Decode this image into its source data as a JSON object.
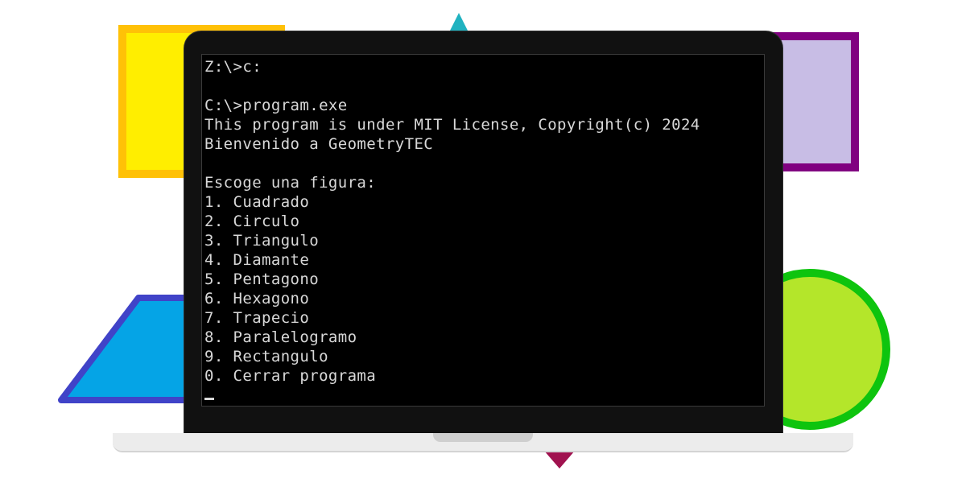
{
  "terminal": {
    "lines": [
      "Z:\\>c:",
      "",
      "C:\\>program.exe",
      "This program is under MIT License, Copyright(c) 2024",
      "Bienvenido a GeometryTEC",
      "",
      "Escoge una figura:",
      "1. Cuadrado",
      "2. Circulo",
      "3. Triangulo",
      "4. Diamante",
      "5. Pentagono",
      "6. Hexagono",
      "7. Trapecio",
      "8. Paralelogramo",
      "9. Rectangulo",
      "0. Cerrar programa",
      ""
    ],
    "text_color": "#d8d8d8",
    "background_color": "#000000"
  },
  "decorative_shapes": [
    {
      "name": "square-shape",
      "fill": "#ffee00",
      "stroke": "#ffc107"
    },
    {
      "name": "purple-square-shape",
      "fill": "#c8bde5",
      "stroke": "#800080"
    },
    {
      "name": "triangle-shape",
      "fill": "#20b2c0"
    },
    {
      "name": "trapezoid-shape",
      "fill": "#05a4e6",
      "stroke": "#4043c8"
    },
    {
      "name": "circle-shape",
      "fill": "#b4e62a",
      "stroke": "#0ec40e"
    },
    {
      "name": "diamond-shape",
      "fill": "#a0124f"
    }
  ]
}
